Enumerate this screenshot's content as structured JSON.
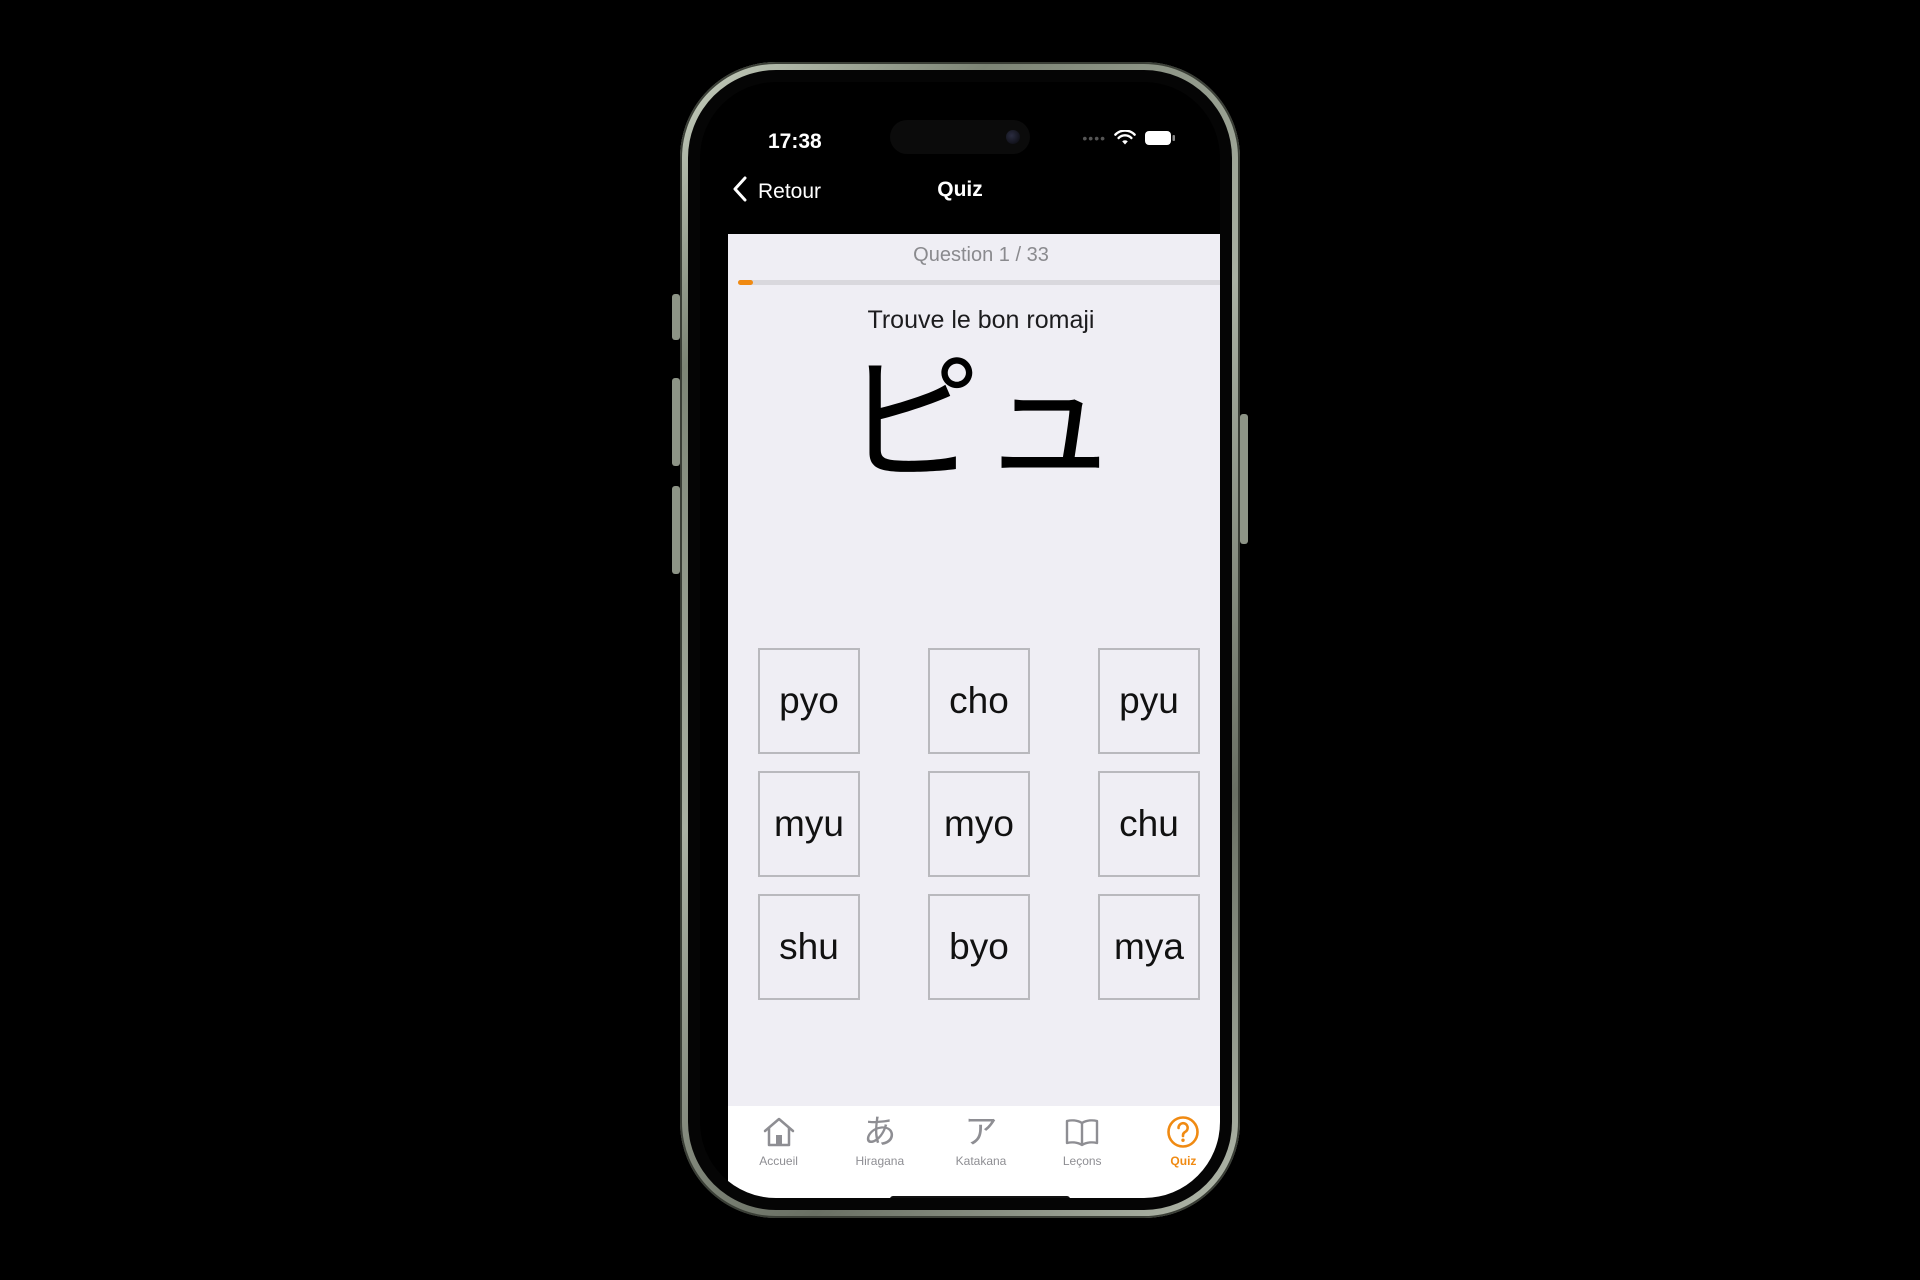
{
  "status_bar": {
    "time": "17:38"
  },
  "nav": {
    "back_label": "Retour",
    "title": "Quiz"
  },
  "quiz": {
    "question_label": "Question 1 / 33",
    "progress_fraction": 0.03,
    "prompt": "Trouve le bon romaji",
    "kana": "ピュ",
    "choices": [
      "pyo",
      "cho",
      "pyu",
      "myu",
      "myo",
      "chu",
      "shu",
      "byo",
      "mya"
    ]
  },
  "tabbar": {
    "tabs": [
      {
        "label": "Accueil",
        "icon": "home-icon"
      },
      {
        "label": "Hiragana",
        "icon": "hiragana-a-icon",
        "glyph": "あ"
      },
      {
        "label": "Katakana",
        "icon": "katakana-a-icon",
        "glyph": "ア"
      },
      {
        "label": "Leçons",
        "icon": "book-icon"
      },
      {
        "label": "Quiz",
        "icon": "question-circle-icon"
      }
    ],
    "active": "Quiz"
  },
  "colors": {
    "accent": "#f08a12",
    "content_background": "#efeef4",
    "inactive_tab": "#8e8e93"
  }
}
